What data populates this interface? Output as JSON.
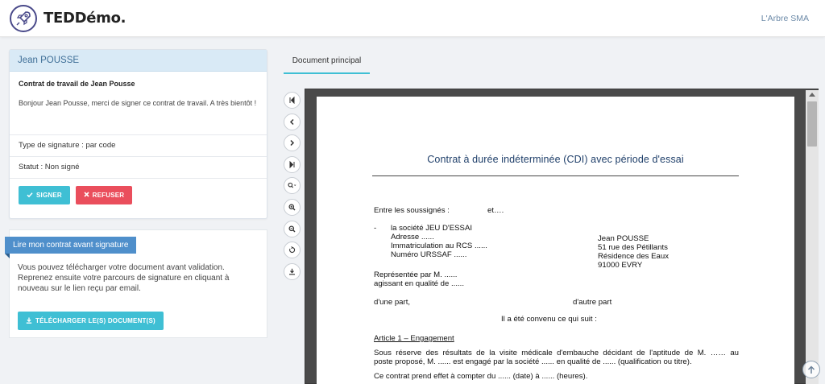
{
  "header": {
    "brand": "TEDDémo.",
    "organization": "L'Arbre SMA"
  },
  "signer_card": {
    "signer_name": "Jean POUSSE",
    "document_title": "Contrat de travail de Jean Pousse",
    "message": "Bonjour Jean Pousse, merci de signer ce contrat de travail. A très bientôt !",
    "signature_type": "Type de signature : par code",
    "status": "Statut : Non signé",
    "sign_label": "SIGNER",
    "refuse_label": "REFUSER"
  },
  "download_panel": {
    "ribbon": "Lire mon contrat avant signature",
    "text": "Vous pouvez télécharger votre document avant validation. Reprenez ensuite votre parcours de signature en cliquant à nouveau sur le lien reçu par email.",
    "button_label": "TÉLÉCHARGER LE(S) DOCUMENT(S)"
  },
  "tabs": [
    {
      "label": "Document principal",
      "active": true
    }
  ],
  "viewer_tools": [
    {
      "name": "first-page",
      "icon": "first-page-icon"
    },
    {
      "name": "previous-page",
      "icon": "chevron-left-icon"
    },
    {
      "name": "next-page",
      "icon": "chevron-right-icon"
    },
    {
      "name": "last-page",
      "icon": "last-page-icon"
    },
    {
      "name": "zoom-menu",
      "icon": "zoom-dropdown-icon"
    },
    {
      "name": "zoom-in",
      "icon": "zoom-in-icon"
    },
    {
      "name": "zoom-out",
      "icon": "zoom-out-icon"
    },
    {
      "name": "rotate",
      "icon": "rotate-icon"
    },
    {
      "name": "download",
      "icon": "download-icon"
    }
  ],
  "document": {
    "title": "Contrat à durée indéterminée (CDI) avec période d'essai",
    "between": "Entre les soussignés :",
    "between_et": "et….",
    "dash": "-",
    "company_line": "la société JEU D'ESSAI",
    "address": "Adresse ......",
    "rcs": "Immatriculation au RCS ......",
    "urssaf": "Numéro URSSAF ......",
    "employee_name": "Jean POUSSE",
    "employee_street": "51 rue des Pétillants",
    "employee_residence": "Résidence des Eaux",
    "employee_city": "91000 EVRY",
    "represented": "Représentée par M. ......",
    "acting_as": "agissant en qualité de ......",
    "one_part": "d'une part,",
    "other_part": "d'autre part",
    "agreed": "Il a été convenu ce qui suit :",
    "article1_title": "Article 1 – Engagement",
    "article1_line1": "Sous réserve des résultats de la visite médicale d'embauche décidant de l'aptitude de M. …… au",
    "article1_line2": "poste proposé, M. ...... est engagé par la société ...... en qualité de ...... (qualification ou titre).",
    "article1_line3": "Ce contrat prend effet à compter du ...... (date) à ...... (heures)."
  },
  "colors": {
    "accent": "#3fbfd4",
    "danger": "#ea4e5c",
    "ribbon": "#4f8fcb",
    "card_head": "#d9eaf6"
  }
}
